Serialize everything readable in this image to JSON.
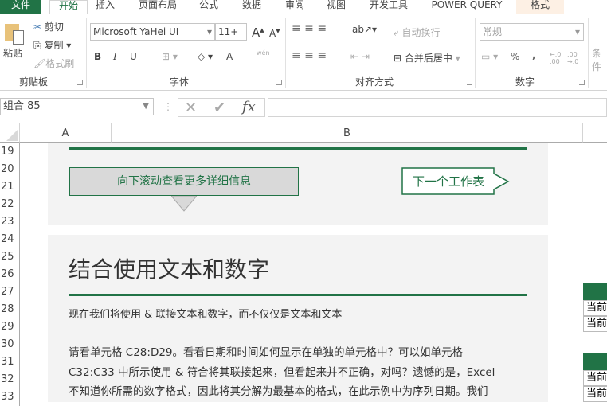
{
  "tabs": [
    "文件",
    "开始",
    "插入",
    "页面布局",
    "公式",
    "数据",
    "审阅",
    "视图",
    "开发工具",
    "POWER QUERY",
    "格式"
  ],
  "clipboard": {
    "paste": "粘贴",
    "cut": "剪切",
    "copy": "复制",
    "format_painter": "格式刷",
    "group": "剪贴板"
  },
  "font": {
    "name": "Microsoft YaHei UI",
    "size": "11+",
    "bold": "B",
    "italic": "I",
    "underline": "U",
    "color": "A",
    "phonetic": "wén",
    "group": "字体"
  },
  "alignment": {
    "wrap": "自动换行",
    "merge": "合并后居中",
    "group": "对齐方式"
  },
  "number": {
    "format": "常规",
    "percent": "%",
    "comma": ",",
    "inc": "←.0 .00",
    "dec": ".00 →.0",
    "group": "数字"
  },
  "styles": {
    "conditional": "条件"
  },
  "formula_bar": {
    "name_box": "组合 85",
    "fx": "fx",
    "formula": ""
  },
  "columns": [
    "A",
    "B"
  ],
  "rows": [
    "19",
    "20",
    "21",
    "22",
    "23",
    "24",
    "25",
    "26",
    "27",
    "28",
    "29",
    "30",
    "31",
    "32",
    "33"
  ],
  "panel1": {
    "scroll_button": "向下滚动查看更多详细信息",
    "next_button": "下一个工作表"
  },
  "panel2": {
    "title": "结合使用文本和数字",
    "subtitle": "现在我们将使用 & 联接文本和数字，而不仅仅是文本和文本",
    "lines": [
      "请看单元格 C28:D29。看看日期和时间如何显示在单独的单元格中？可以如单元格",
      "C32:C33 中所示使用 & 符合将其联接起来，但看起来并不正确，对吗？遗憾的是，Excel",
      "不知道你所需的数字格式，因此将其分解为最基本的格式，在此示例中为序列日期。我们"
    ]
  },
  "right_tables": [
    {
      "rows": [
        "当前",
        "当前"
      ]
    },
    {
      "rows": [
        "当前",
        "当前"
      ]
    }
  ],
  "colors": {
    "accent": "#217346",
    "panel": "#f3f3f3"
  }
}
